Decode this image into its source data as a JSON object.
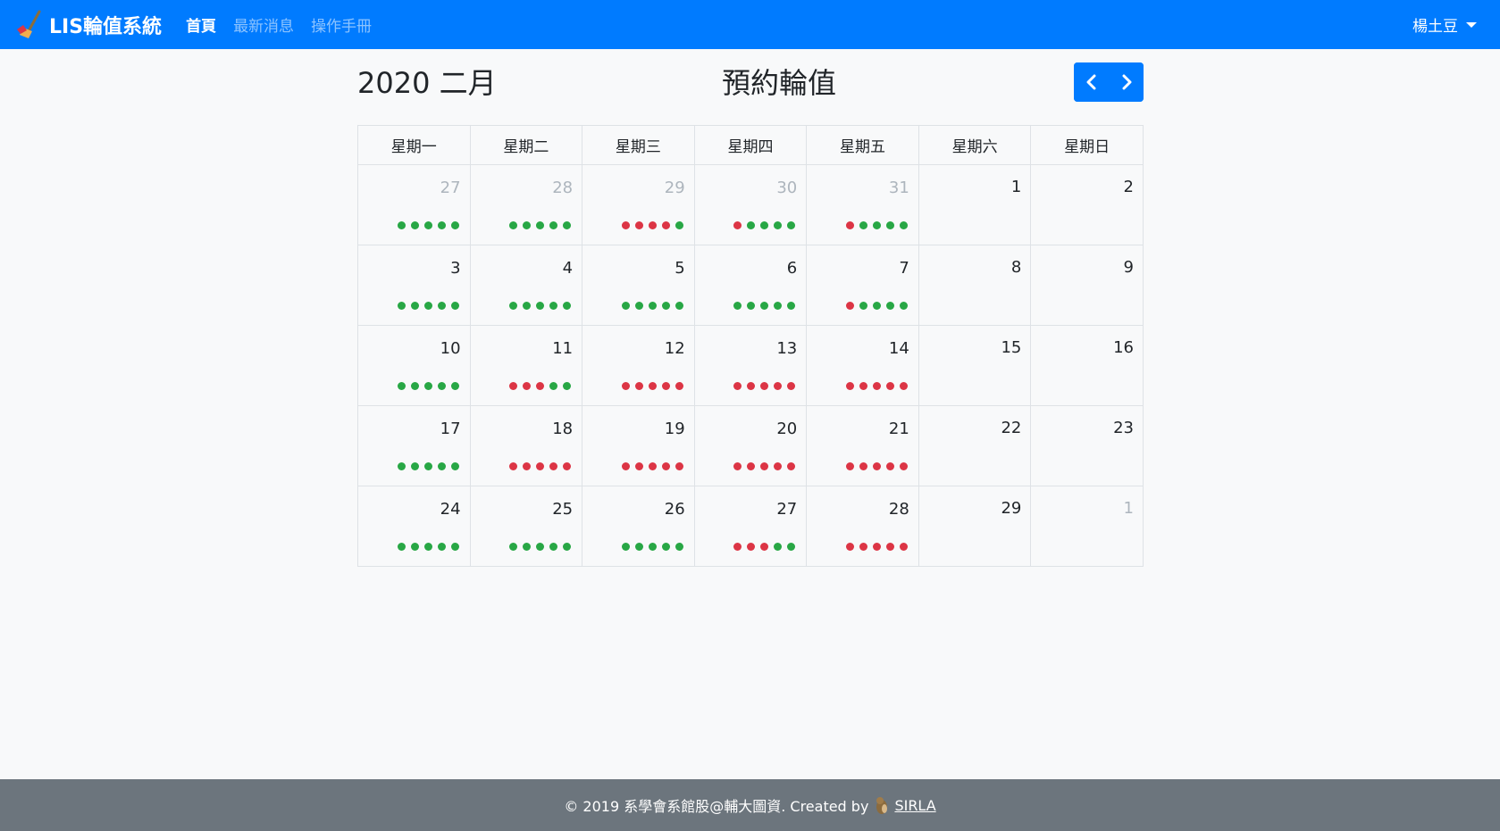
{
  "navbar": {
    "brand": "LIS輪值系統",
    "links": [
      {
        "label": "首頁",
        "active": true
      },
      {
        "label": "最新消息",
        "active": false
      },
      {
        "label": "操作手冊",
        "active": false
      }
    ],
    "user": "楊土豆"
  },
  "header": {
    "month_title": "2020 二月",
    "page_heading": "預約輪值"
  },
  "calendar": {
    "weekdays": [
      "星期一",
      "星期二",
      "星期三",
      "星期四",
      "星期五",
      "星期六",
      "星期日"
    ],
    "weeks": [
      [
        {
          "day": "27",
          "other": true,
          "dots": "ggggg"
        },
        {
          "day": "28",
          "other": true,
          "dots": "ggggg"
        },
        {
          "day": "29",
          "other": true,
          "dots": "rrrrg"
        },
        {
          "day": "30",
          "other": true,
          "dots": "rgggg"
        },
        {
          "day": "31",
          "other": true,
          "dots": "rgggg"
        },
        {
          "day": "1",
          "other": false,
          "dots": ""
        },
        {
          "day": "2",
          "other": false,
          "dots": ""
        }
      ],
      [
        {
          "day": "3",
          "other": false,
          "dots": "ggggg"
        },
        {
          "day": "4",
          "other": false,
          "dots": "ggggg"
        },
        {
          "day": "5",
          "other": false,
          "dots": "ggggg"
        },
        {
          "day": "6",
          "other": false,
          "dots": "ggggg"
        },
        {
          "day": "7",
          "other": false,
          "dots": "rgggg"
        },
        {
          "day": "8",
          "other": false,
          "dots": ""
        },
        {
          "day": "9",
          "other": false,
          "dots": ""
        }
      ],
      [
        {
          "day": "10",
          "other": false,
          "dots": "ggggg"
        },
        {
          "day": "11",
          "other": false,
          "dots": "rrrgg"
        },
        {
          "day": "12",
          "other": false,
          "dots": "rrrrr"
        },
        {
          "day": "13",
          "other": false,
          "dots": "rrrrr"
        },
        {
          "day": "14",
          "other": false,
          "dots": "rrrrr"
        },
        {
          "day": "15",
          "other": false,
          "dots": ""
        },
        {
          "day": "16",
          "other": false,
          "dots": ""
        }
      ],
      [
        {
          "day": "17",
          "other": false,
          "dots": "ggggg"
        },
        {
          "day": "18",
          "other": false,
          "dots": "rrrrr"
        },
        {
          "day": "19",
          "other": false,
          "dots": "rrrrr"
        },
        {
          "day": "20",
          "other": false,
          "dots": "rrrrr"
        },
        {
          "day": "21",
          "other": false,
          "dots": "rrrrr"
        },
        {
          "day": "22",
          "other": false,
          "dots": ""
        },
        {
          "day": "23",
          "other": false,
          "dots": ""
        }
      ],
      [
        {
          "day": "24",
          "other": false,
          "dots": "ggggg"
        },
        {
          "day": "25",
          "other": false,
          "dots": "ggggg"
        },
        {
          "day": "26",
          "other": false,
          "dots": "ggggg"
        },
        {
          "day": "27",
          "other": false,
          "dots": "rrrgg"
        },
        {
          "day": "28",
          "other": false,
          "dots": "rrrrr"
        },
        {
          "day": "29",
          "other": false,
          "dots": ""
        },
        {
          "day": "1",
          "other": true,
          "dots": ""
        }
      ]
    ]
  },
  "colors": {
    "primary": "#007bff",
    "available": "#28a745",
    "booked": "#dc3545",
    "footer": "#6c757d"
  },
  "footer": {
    "text": "© 2019 系學會系館股@輔大圖資. Created by",
    "link": "SIRLA"
  }
}
